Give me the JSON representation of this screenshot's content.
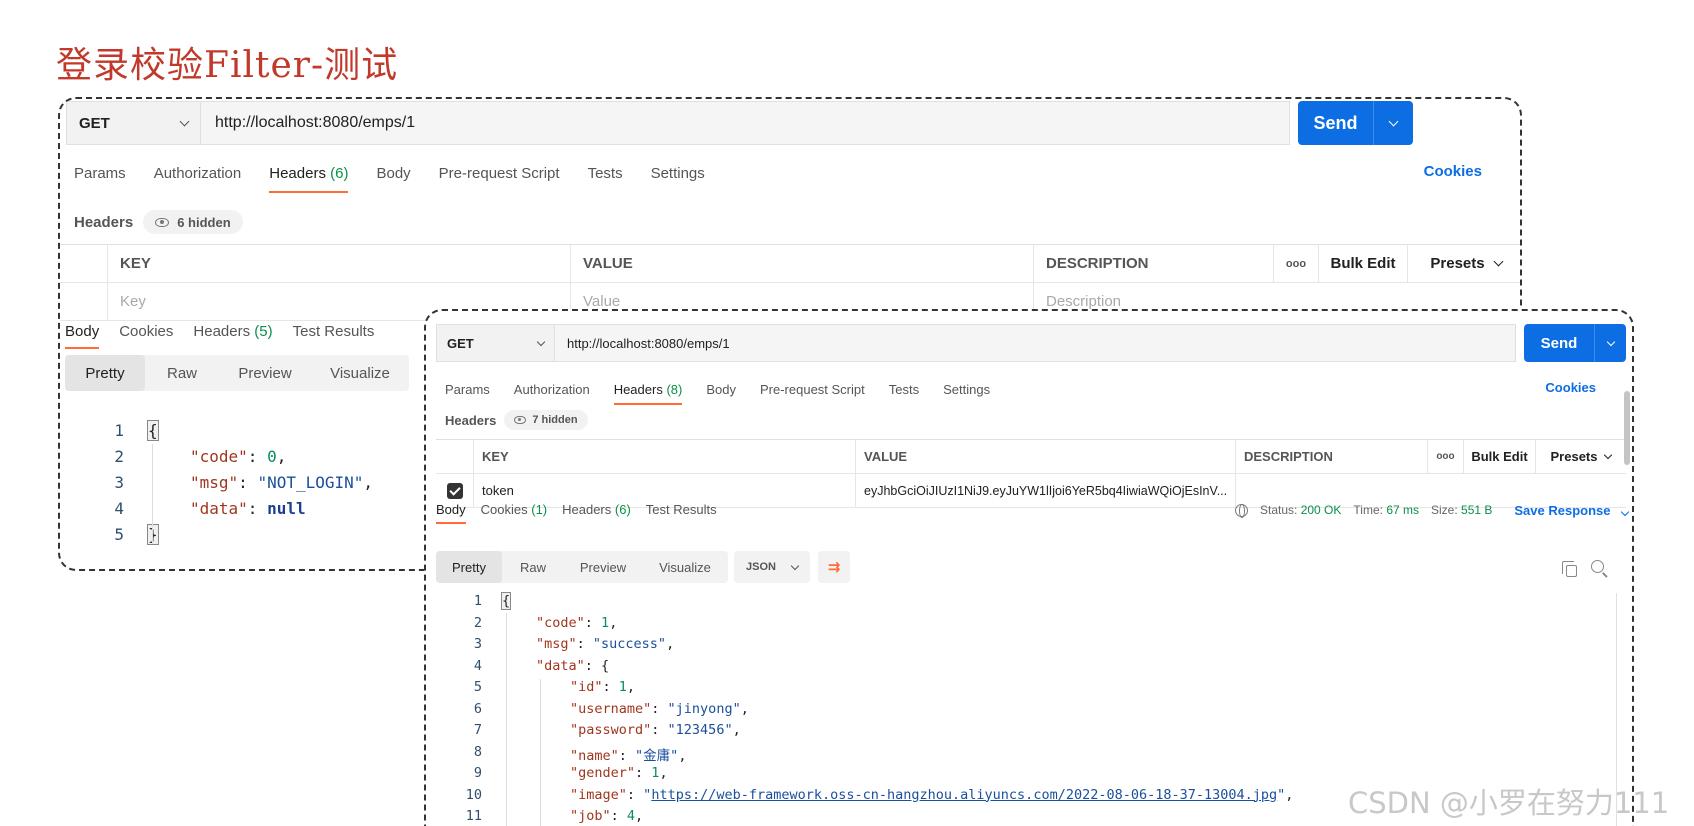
{
  "slide_title": "登录校验Filter-测试",
  "watermark": "CSDN @小罗在努力111",
  "left_panel": {
    "method": "GET",
    "url": "http://localhost:8080/emps/1",
    "send_label": "Send",
    "tabs": [
      {
        "label": "Params"
      },
      {
        "label": "Authorization"
      },
      {
        "label": "Headers",
        "count": "(6)",
        "active": true
      },
      {
        "label": "Body"
      },
      {
        "label": "Pre-request Script"
      },
      {
        "label": "Tests"
      },
      {
        "label": "Settings"
      }
    ],
    "cookies_label": "Cookies",
    "headers_label": "Headers",
    "hidden_label": "6 hidden",
    "table": {
      "col_key": "KEY",
      "col_value": "VALUE",
      "col_description": "DESCRIPTION",
      "more": "ooo",
      "bulk_edit": "Bulk Edit",
      "presets": "Presets",
      "placeholder_key": "Key",
      "placeholder_value": "Value",
      "placeholder_description": "Description"
    },
    "response_tabs": [
      {
        "label": "Body",
        "active": true
      },
      {
        "label": "Cookies"
      },
      {
        "label": "Headers",
        "count": "(5)"
      },
      {
        "label": "Test Results"
      }
    ],
    "view_tabs": [
      "Pretty",
      "Raw",
      "Preview",
      "Visualize"
    ],
    "code_lines": [
      "1",
      "2",
      "3",
      "4",
      "5"
    ]
  },
  "right_panel": {
    "method": "GET",
    "url": "http://localhost:8080/emps/1",
    "send_label": "Send",
    "tabs": [
      {
        "label": "Params"
      },
      {
        "label": "Authorization"
      },
      {
        "label": "Headers",
        "count": "(8)",
        "active": true
      },
      {
        "label": "Body"
      },
      {
        "label": "Pre-request Script"
      },
      {
        "label": "Tests"
      },
      {
        "label": "Settings"
      }
    ],
    "cookies_label": "Cookies",
    "headers_label": "Headers",
    "hidden_label": "7 hidden",
    "table": {
      "col_key": "KEY",
      "col_value": "VALUE",
      "col_description": "DESCRIPTION",
      "more": "ooo",
      "bulk_edit": "Bulk Edit",
      "presets": "Presets",
      "row_key": "token",
      "row_value": "eyJhbGciOiJIUzI1NiJ9.eyJuYW1lIjoi6YeR5bq4IiwiaWQiOjEsInV..."
    },
    "response_tabs": [
      {
        "label": "Body",
        "active": true
      },
      {
        "label": "Cookies",
        "count": "(1)"
      },
      {
        "label": "Headers",
        "count": "(6)"
      },
      {
        "label": "Test Results"
      }
    ],
    "status": {
      "status_label": "Status:",
      "status_value": "200 OK",
      "time_label": "Time:",
      "time_value": "67 ms",
      "size_label": "Size:",
      "size_value": "551 B",
      "save_response": "Save Response"
    },
    "view_tabs": [
      "Pretty",
      "Raw",
      "Preview",
      "Visualize"
    ],
    "format": "JSON",
    "code_lines": [
      "1",
      "2",
      "3",
      "4",
      "5",
      "6",
      "7",
      "8",
      "9",
      "10",
      "11"
    ],
    "image_url": "https://web-framework.oss-cn-hangzhou.aliyuncs.com/2022-08-06-18-37-13004.jpg"
  },
  "colors": {
    "send": "#0d6ee4",
    "active_tab": "#ff6c37",
    "count": "#0b8f4a",
    "title": "#c0392b"
  }
}
